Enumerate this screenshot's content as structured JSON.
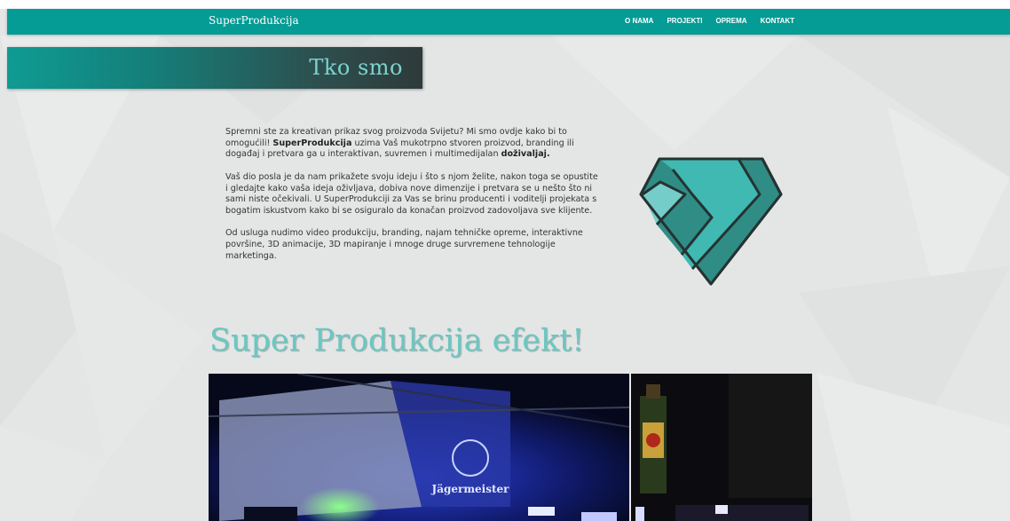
{
  "header": {
    "brand": "SuperProdukcija",
    "nav": [
      "O NAMA",
      "PROJEKTI",
      "OPREMA",
      "KONTAKT"
    ]
  },
  "about": {
    "title": "Tko smo",
    "p1": {
      "a": "Spremni ste za kreativan prikaz svog proizvoda Svijetu? Mi smo ovdje kako bi to omogućili! ",
      "b": "SuperProdukcija",
      "c": " uzima Vaš mukotrpno stvoren proizvod, branding ili događaj i pretvara ga u interaktivan, suvremen i multimedijalan ",
      "d": "doživaljaj."
    },
    "p2": "Vaš dio posla je da nam prikažete svoju ideju i što s njom želite, nakon toga se opustite i gledajte kako vaša ideja oživljava, dobiva nove dimenzije i pretvara se u nešto što ni sami niste očekivali. U SuperProdukciji za Vas se brinu producenti i voditelji projekata s bogatim iskustvom kako bi se osiguralo da konačan proizvod zadovoljava sve klijente.",
    "p3": "Od usluga nudimo video produkciju, branding, najam tehničke opreme, interaktivne površine, 3D animacije, 3D mapiranje i mnoge druge survremene tehnologije marketinga."
  },
  "effect": {
    "title": "Super Produkcija efekt!"
  },
  "gallery": {
    "banner_text": "Jägermeister"
  },
  "colors": {
    "accent": "#049c95",
    "heading": "#6cc7c1"
  }
}
